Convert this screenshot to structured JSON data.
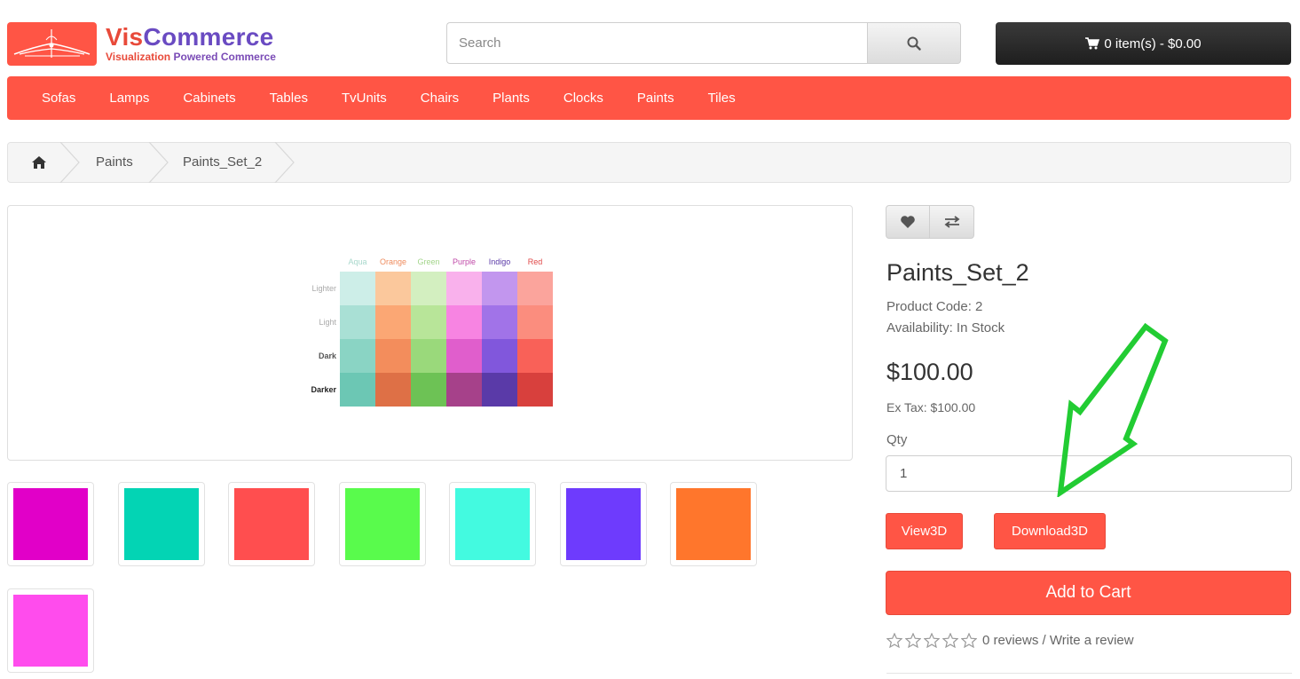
{
  "brand": {
    "name_part1": "Vis",
    "name_part2": "Commerce",
    "tagline_part1": "Visualization",
    "tagline_part2": "Powered Commerce"
  },
  "search": {
    "placeholder": "Search",
    "value": "",
    "icon": "search-icon"
  },
  "cart": {
    "label": "0 item(s) - $0.00",
    "icon": "cart-icon"
  },
  "nav": {
    "items": [
      "Sofas",
      "Lamps",
      "Cabinets",
      "Tables",
      "TvUnits",
      "Chairs",
      "Plants",
      "Clocks",
      "Paints",
      "Tiles"
    ]
  },
  "breadcrumb": {
    "home_icon": "home-icon",
    "items": [
      "Paints",
      "Paints_Set_2"
    ]
  },
  "main_image": {
    "columns": [
      "Aqua",
      "Orange",
      "Green",
      "Purple",
      "Indigo",
      "Red"
    ],
    "rows": [
      "Lighter",
      "Light",
      "Dark",
      "Darker"
    ],
    "colors": [
      [
        "#cdeee8",
        "#fbc89c",
        "#d3efc0",
        "#f9b1ec",
        "#c296ee",
        "#fba49c"
      ],
      [
        "#a9e0d5",
        "#fba774",
        "#b8e599",
        "#f784e2",
        "#a173e8",
        "#fb8d7e"
      ],
      [
        "#8ad4c4",
        "#f38d5c",
        "#9ad97b",
        "#e05ecc",
        "#8157dc",
        "#f96158"
      ],
      [
        "#6cc7b4",
        "#de7046",
        "#6dc255",
        "#a6418a",
        "#5a3aa8",
        "#d8403d"
      ]
    ],
    "label_colors": {
      "columns": [
        "#a8d8cc",
        "#ef8c5e",
        "#a3d58b",
        "#c04aa8",
        "#5b3aa8",
        "#e04848"
      ],
      "rows": [
        "#aaaaaa",
        "#aaaaaa",
        "#555555",
        "#222222"
      ]
    }
  },
  "thumbnails": [
    "#e100c8",
    "#03d4b4",
    "#ff4e4f",
    "#59fb4c",
    "#43fae0",
    "#6e3bfd",
    "#ff762c",
    "#ff4ced"
  ],
  "product": {
    "title": "Paints_Set_2",
    "code": "Product Code: 2",
    "availability": "Availability: In Stock",
    "price": "$100.00",
    "ex_tax": "Ex Tax: $100.00",
    "qty_label": "Qty",
    "qty_value": "1",
    "view3d_label": "View3D",
    "download3d_label": "Download3D",
    "add_to_cart_label": "Add to Cart",
    "wishlist_icon": "heart-icon",
    "compare_icon": "exchange-icon",
    "review_text": "0 reviews / Write a review",
    "stars": 0
  },
  "colors": {
    "accent": "#ff5545",
    "arrow": "#22cc33"
  }
}
